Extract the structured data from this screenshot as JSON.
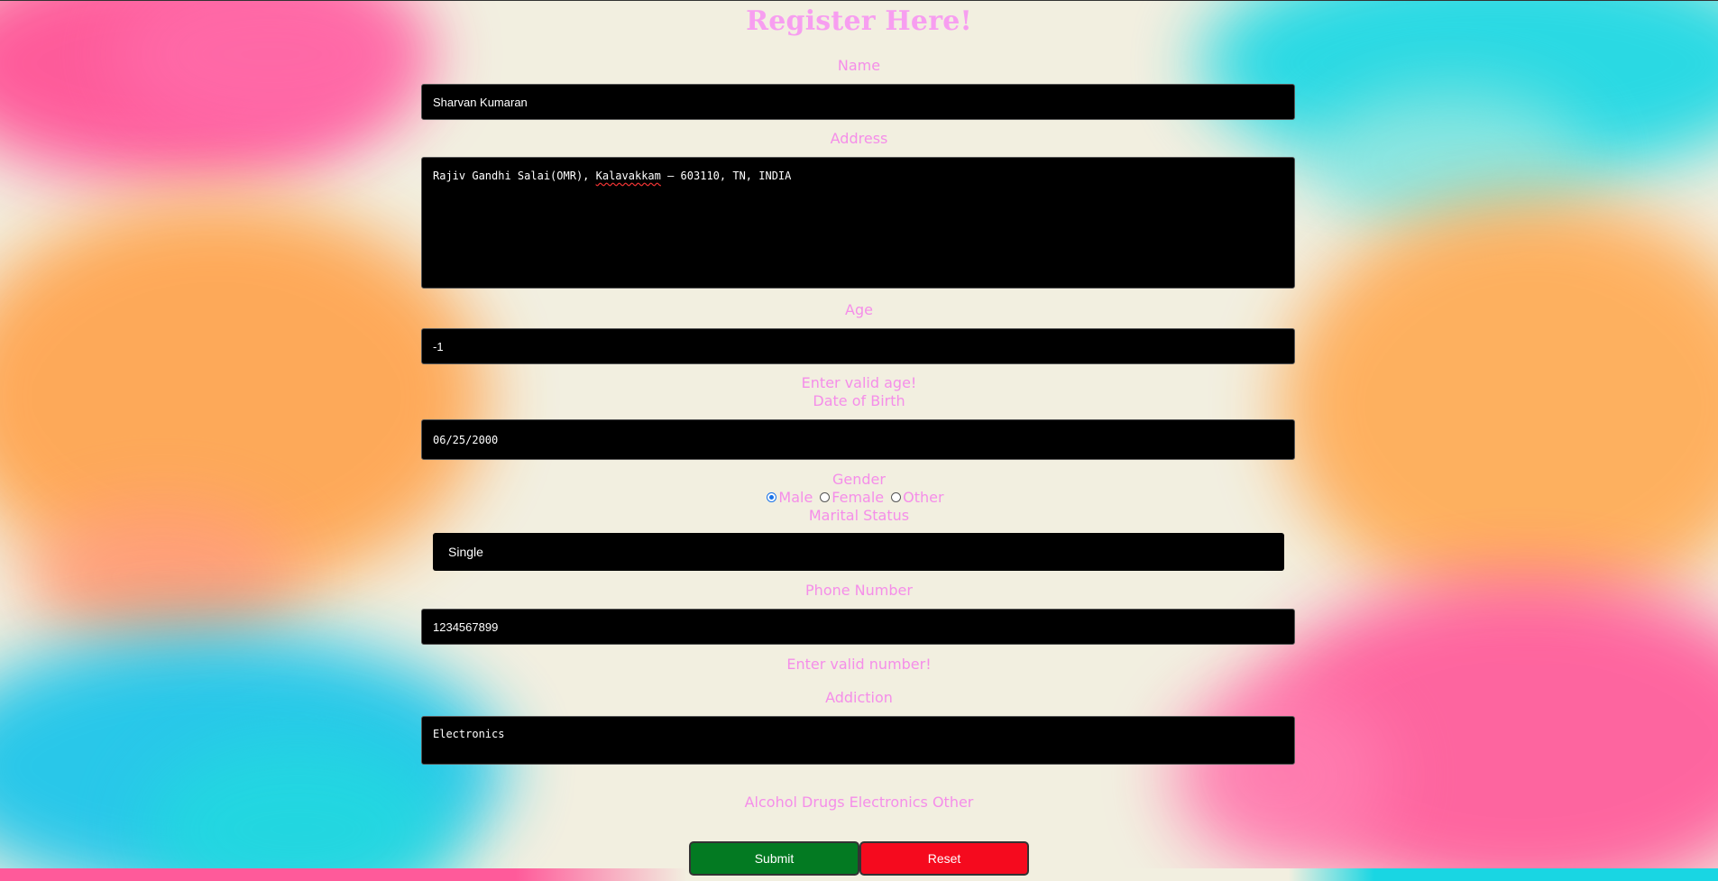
{
  "title": "Register Here!",
  "colors": {
    "label": "#f58ee9",
    "title": "#f79ef0",
    "field_bg": "#000000",
    "submit": "#037a22",
    "reset": "#f50a1e",
    "radio_accent": "#1a73e8"
  },
  "name": {
    "label": "Name",
    "value": "Sharvan Kumaran"
  },
  "address": {
    "label": "Address",
    "value_before": "Rajiv Gandhi Salai(OMR), ",
    "value_misspelled": "Kalavakkam",
    "value_after": " – 603110, TN, INDIA"
  },
  "age": {
    "label": "Age",
    "value": "-1",
    "error": "Enter valid age!"
  },
  "dob": {
    "label": "Date of Birth",
    "value": "06/25/2000"
  },
  "gender": {
    "label": "Gender",
    "options": [
      "Male",
      "Female",
      "Other"
    ],
    "selected": "Male"
  },
  "marital": {
    "label": "Marital Status",
    "value": "Single"
  },
  "phone": {
    "label": "Phone Number",
    "value": "1234567899",
    "error": "Enter valid number!"
  },
  "addiction": {
    "label": "Addiction",
    "value": "Electronics",
    "options_text": "Alcohol Drugs Electronics Other"
  },
  "buttons": {
    "submit": "Submit",
    "reset": "Reset"
  }
}
